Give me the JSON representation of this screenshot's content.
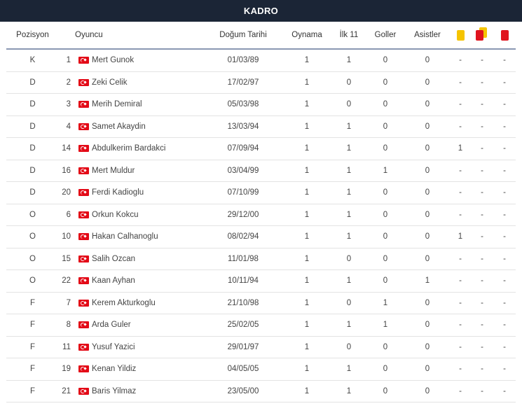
{
  "header": {
    "title": "KADRO"
  },
  "columns": {
    "position": "Pozisyon",
    "player": "Oyuncu",
    "dob": "Doğum Tarihi",
    "apps": "Oynama",
    "first11": "İlk 11",
    "goals": "Goller",
    "assists": "Asistler"
  },
  "card_icons": {
    "yellow": "yellow-card-icon",
    "second_yellow": "second-yellow-card-icon",
    "red": "red-card-icon",
    "yellow_color": "#f5c400",
    "red_color": "#e0141e"
  },
  "flag": {
    "country": "Turkey",
    "icon": "turkey-flag-icon",
    "color": "#e30a17"
  },
  "colors": {
    "title_bg": "#1b2536",
    "header_border": "#8a98b3"
  },
  "players": [
    {
      "pos": "K",
      "num": "1",
      "name": "Mert Gunok",
      "dob": "01/03/89",
      "apps": "1",
      "first11": "1",
      "goals": "0",
      "assists": "0",
      "yc": "-",
      "yrc": "-",
      "rc": "-"
    },
    {
      "pos": "D",
      "num": "2",
      "name": "Zeki Celik",
      "dob": "17/02/97",
      "apps": "1",
      "first11": "0",
      "goals": "0",
      "assists": "0",
      "yc": "-",
      "yrc": "-",
      "rc": "-"
    },
    {
      "pos": "D",
      "num": "3",
      "name": "Merih Demiral",
      "dob": "05/03/98",
      "apps": "1",
      "first11": "0",
      "goals": "0",
      "assists": "0",
      "yc": "-",
      "yrc": "-",
      "rc": "-"
    },
    {
      "pos": "D",
      "num": "4",
      "name": "Samet Akaydin",
      "dob": "13/03/94",
      "apps": "1",
      "first11": "1",
      "goals": "0",
      "assists": "0",
      "yc": "-",
      "yrc": "-",
      "rc": "-"
    },
    {
      "pos": "D",
      "num": "14",
      "name": "Abdulkerim Bardakci",
      "dob": "07/09/94",
      "apps": "1",
      "first11": "1",
      "goals": "0",
      "assists": "0",
      "yc": "1",
      "yrc": "-",
      "rc": "-"
    },
    {
      "pos": "D",
      "num": "16",
      "name": "Mert Muldur",
      "dob": "03/04/99",
      "apps": "1",
      "first11": "1",
      "goals": "1",
      "assists": "0",
      "yc": "-",
      "yrc": "-",
      "rc": "-"
    },
    {
      "pos": "D",
      "num": "20",
      "name": "Ferdi Kadioglu",
      "dob": "07/10/99",
      "apps": "1",
      "first11": "1",
      "goals": "0",
      "assists": "0",
      "yc": "-",
      "yrc": "-",
      "rc": "-"
    },
    {
      "pos": "O",
      "num": "6",
      "name": "Orkun Kokcu",
      "dob": "29/12/00",
      "apps": "1",
      "first11": "1",
      "goals": "0",
      "assists": "0",
      "yc": "-",
      "yrc": "-",
      "rc": "-"
    },
    {
      "pos": "O",
      "num": "10",
      "name": "Hakan Calhanoglu",
      "dob": "08/02/94",
      "apps": "1",
      "first11": "1",
      "goals": "0",
      "assists": "0",
      "yc": "1",
      "yrc": "-",
      "rc": "-"
    },
    {
      "pos": "O",
      "num": "15",
      "name": "Salih Ozcan",
      "dob": "11/01/98",
      "apps": "1",
      "first11": "0",
      "goals": "0",
      "assists": "0",
      "yc": "-",
      "yrc": "-",
      "rc": "-"
    },
    {
      "pos": "O",
      "num": "22",
      "name": "Kaan Ayhan",
      "dob": "10/11/94",
      "apps": "1",
      "first11": "1",
      "goals": "0",
      "assists": "1",
      "yc": "-",
      "yrc": "-",
      "rc": "-"
    },
    {
      "pos": "F",
      "num": "7",
      "name": "Kerem Akturkoglu",
      "dob": "21/10/98",
      "apps": "1",
      "first11": "0",
      "goals": "1",
      "assists": "0",
      "yc": "-",
      "yrc": "-",
      "rc": "-"
    },
    {
      "pos": "F",
      "num": "8",
      "name": "Arda Guler",
      "dob": "25/02/05",
      "apps": "1",
      "first11": "1",
      "goals": "1",
      "assists": "0",
      "yc": "-",
      "yrc": "-",
      "rc": "-"
    },
    {
      "pos": "F",
      "num": "11",
      "name": "Yusuf Yazici",
      "dob": "29/01/97",
      "apps": "1",
      "first11": "0",
      "goals": "0",
      "assists": "0",
      "yc": "-",
      "yrc": "-",
      "rc": "-"
    },
    {
      "pos": "F",
      "num": "19",
      "name": "Kenan Yildiz",
      "dob": "04/05/05",
      "apps": "1",
      "first11": "1",
      "goals": "0",
      "assists": "0",
      "yc": "-",
      "yrc": "-",
      "rc": "-"
    },
    {
      "pos": "F",
      "num": "21",
      "name": "Baris Yilmaz",
      "dob": "23/05/00",
      "apps": "1",
      "first11": "1",
      "goals": "0",
      "assists": "0",
      "yc": "-",
      "yrc": "-",
      "rc": "-"
    }
  ]
}
